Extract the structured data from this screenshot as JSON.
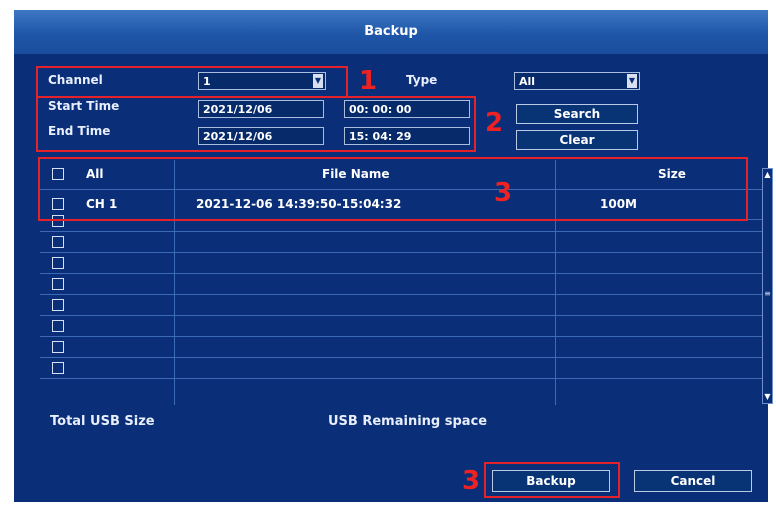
{
  "dialog": {
    "title": "Backup"
  },
  "filters": {
    "channel_label": "Channel",
    "channel_value": "1",
    "type_label": "Type",
    "type_value": "All",
    "start_time_label": "Start Time",
    "start_date": "2021/12/06",
    "start_time": "00: 00: 00",
    "end_time_label": "End Time",
    "end_date": "2021/12/06",
    "end_time": "15: 04: 29",
    "search_label": "Search",
    "clear_label": "Clear"
  },
  "table": {
    "headers": {
      "all": "All",
      "file_name": "File Name",
      "size": "Size"
    },
    "rows": [
      {
        "channel": "CH 1",
        "file_name": "2021-12-06 14:39:50-15:04:32",
        "size": "100M"
      }
    ],
    "empty_rows": 8
  },
  "storage": {
    "total_label": "Total USB Size",
    "remaining_label": "USB Remaining space"
  },
  "actions": {
    "backup_label": "Backup",
    "cancel_label": "Cancel"
  },
  "annotations": {
    "n1": "1",
    "n2": "2",
    "n3a": "3",
    "n3b": "3"
  },
  "icons": {
    "dropdown": "dropdown-arrow-icon",
    "scroll_up": "scroll-up-icon",
    "scroll_down": "scroll-down-icon"
  },
  "colors": {
    "dialog_bg": "#0a2f78",
    "title_bar": "#1f56a8",
    "annotation_red": "#e5222a"
  }
}
